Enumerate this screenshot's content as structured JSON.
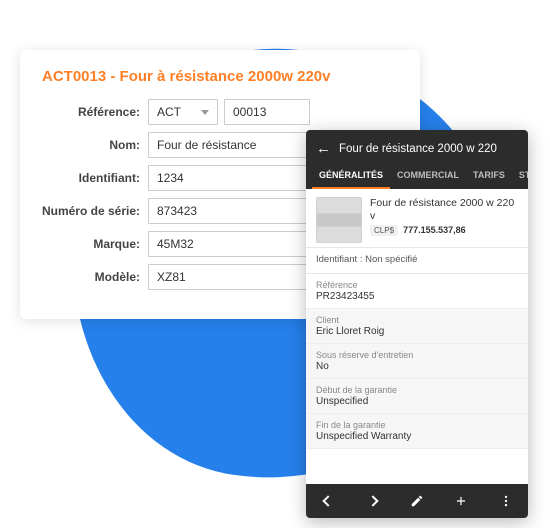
{
  "card": {
    "title": "ACT0013 - Four à résistance 2000w 220v",
    "fields": {
      "reference_label": "Référence:",
      "reference_prefix": "ACT",
      "reference_num": "00013",
      "nom_label": "Nom:",
      "nom_value": "Four de résistance",
      "identifiant_label": "Identifiant:",
      "identifiant_value": "1234",
      "serie_label": "Numéro de série:",
      "serie_value": "873423",
      "marque_label": "Marque:",
      "marque_value": "45M32",
      "modele_label": "Modèle:",
      "modele_value": "XZ81"
    }
  },
  "phone": {
    "title": "Four de résistance 2000 w 220",
    "tabs": {
      "generalites": "GÉNÉRALITÉS",
      "commercial": "COMMERCIAL",
      "tarifs": "TARIFS",
      "stock": "STOCK"
    },
    "summary": {
      "title": "Four de résistance 2000 w 220 v",
      "badge": "CLP$",
      "price": "777.155.537,86"
    },
    "identifiant_line": "Identifiant : Non spécifié",
    "sections": {
      "ref_label": "Référence",
      "ref_value": "PR23423455",
      "client_label": "Client",
      "client_value": "Eric Lloret Roig",
      "maint_label": "Sous réserve d'entretien",
      "maint_value": "No",
      "start_label": "Début de la garantie",
      "start_value": "Unspecified",
      "end_label": "Fin de la garantie",
      "end_value": "Unspecified Warranty"
    }
  }
}
